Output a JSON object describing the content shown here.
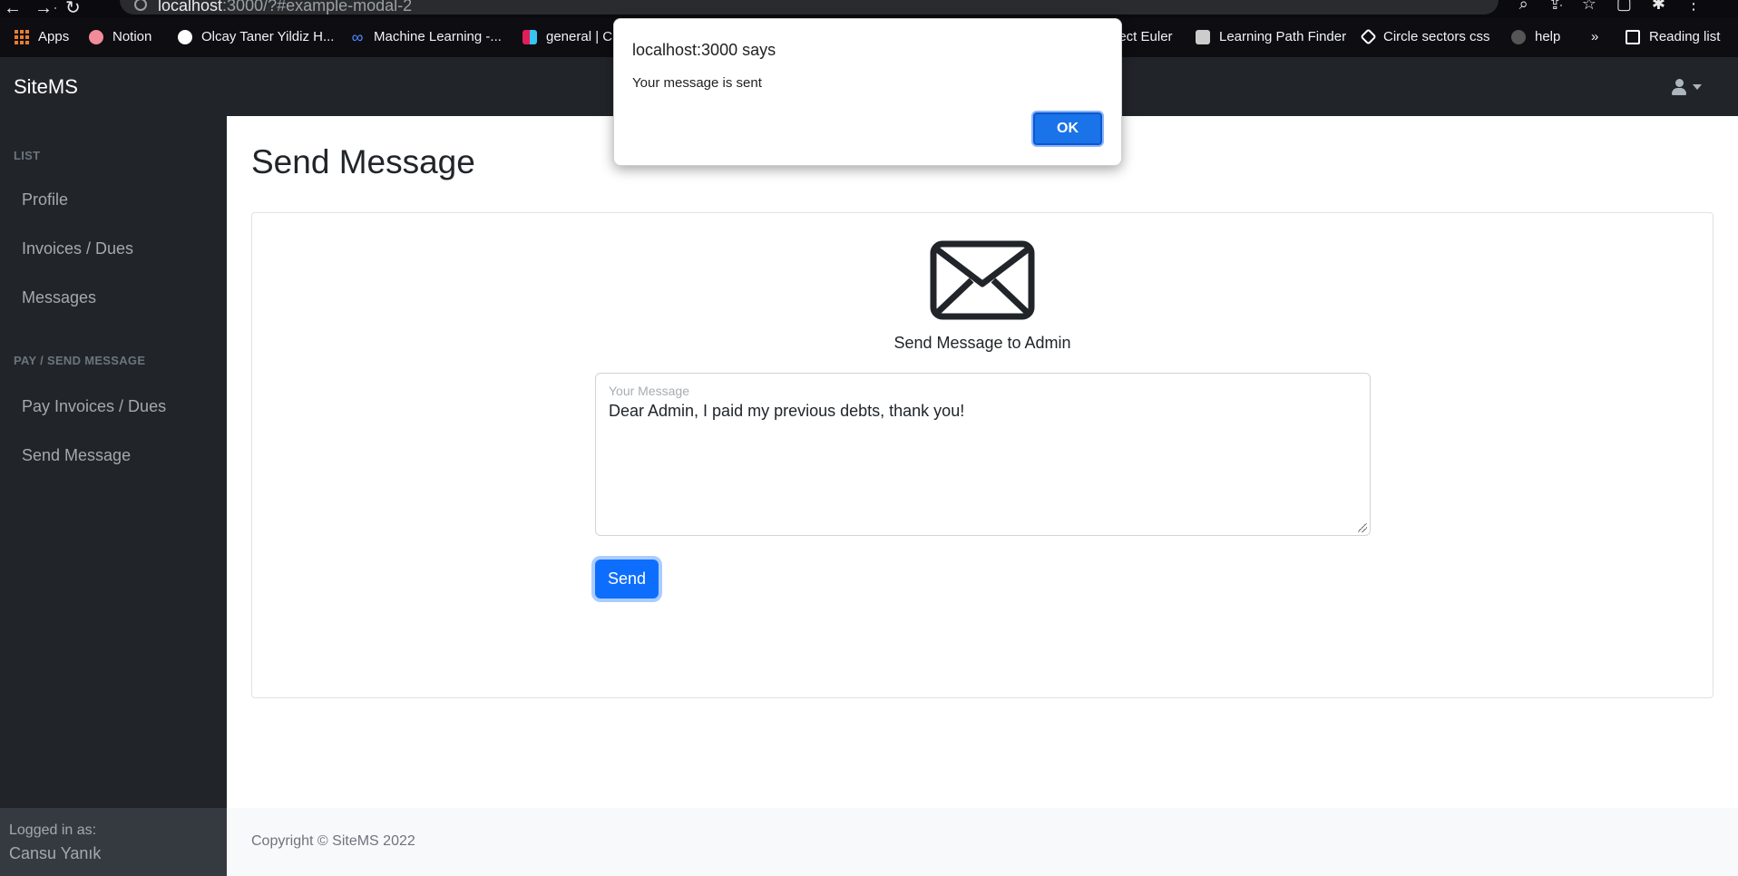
{
  "browser": {
    "address": {
      "host": "localhost",
      "rest": ":3000/?#example-modal-2"
    },
    "bookmarks": [
      {
        "label": "Apps",
        "icon": "apps-grid-icon",
        "color": "#e87f2e"
      },
      {
        "label": "Notion",
        "icon": "brain-icon",
        "color": "#f28b9a"
      },
      {
        "label": "Olcay Taner Yildiz H...",
        "icon": "globe-icon",
        "color": "#ffffff"
      },
      {
        "label": "Machine Learning -...",
        "icon": "infinity-icon",
        "color": "#4f8cff"
      },
      {
        "label": "general | C",
        "icon": "slack-icon",
        "color": "#e01e5a"
      },
      {
        "label": "ject Euler",
        "icon": "",
        "color": ""
      },
      {
        "label": "Learning Path Finder",
        "icon": "learning-path-icon",
        "color": "#cccccc"
      },
      {
        "label": "Circle sectors css",
        "icon": "codepen-icon",
        "color": "#ffffff"
      },
      {
        "label": "help",
        "icon": "github-icon",
        "color": "#aaaaaa"
      },
      {
        "label": "»",
        "icon": "",
        "color": ""
      },
      {
        "label": "Reading list",
        "icon": "reading-list-icon",
        "color": "#ffffff"
      }
    ]
  },
  "app": {
    "brand": "SiteMS",
    "user_menu_icon": "user-icon"
  },
  "sidebar": {
    "section1": "LIST",
    "section1_items": [
      "Profile",
      "Invoices / Dues",
      "Messages"
    ],
    "section2": "PAY / SEND MESSAGE",
    "section2_items": [
      "Pay Invoices / Dues",
      "Send Message"
    ],
    "footer_label": "Logged in as:",
    "footer_user": "Cansu Yanık"
  },
  "main": {
    "title": "Send Message",
    "subtitle": "Send Message to Admin",
    "message_label": "Your Message",
    "message_value": "Dear Admin, I paid my previous debts, thank you!",
    "send_label": "Send",
    "icon": "envelope-icon"
  },
  "footer": {
    "copyright": "Copyright © SiteMS 2022"
  },
  "alert": {
    "title": "localhost:3000 says",
    "message": "Your message is sent",
    "ok_label": "OK"
  },
  "colors": {
    "primary": "#0d6efd",
    "sidebar": "#212529",
    "alert_button": "#1a73e8"
  }
}
